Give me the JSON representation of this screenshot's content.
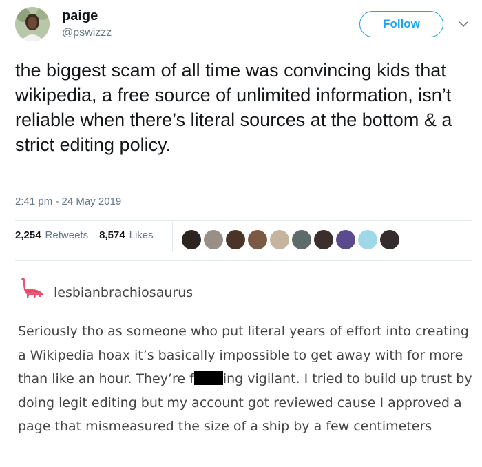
{
  "tweet": {
    "display_name": "paige",
    "handle": "@pswizzz",
    "follow_label": "Follow",
    "text": "the biggest scam of all time was convincing kids that wikipedia, a free source of unlimited information, isn’t reliable when there’s literal sources at the bottom & a strict editing policy.",
    "timestamp": "2:41 pm - 24 May 2019",
    "retweets_count": "2,254",
    "retweets_label": "Retweets",
    "likes_count": "8,574",
    "likes_label": "Likes",
    "accent_color": "#1da1f2"
  },
  "reply_post": {
    "username": "lesbianbrachiosaurus",
    "body_before_censor": "Seriously tho as someone who put literal years of effort into creating a Wikipedia hoax it’s basically impossible to get away with for more than like an hour. They’re f",
    "body_after_censor": "ing vigilant. I tried to build up trust by doing legit editing but my account got reviewed cause I approved a page that mismeasured the size of a ship by a few centimeters"
  }
}
